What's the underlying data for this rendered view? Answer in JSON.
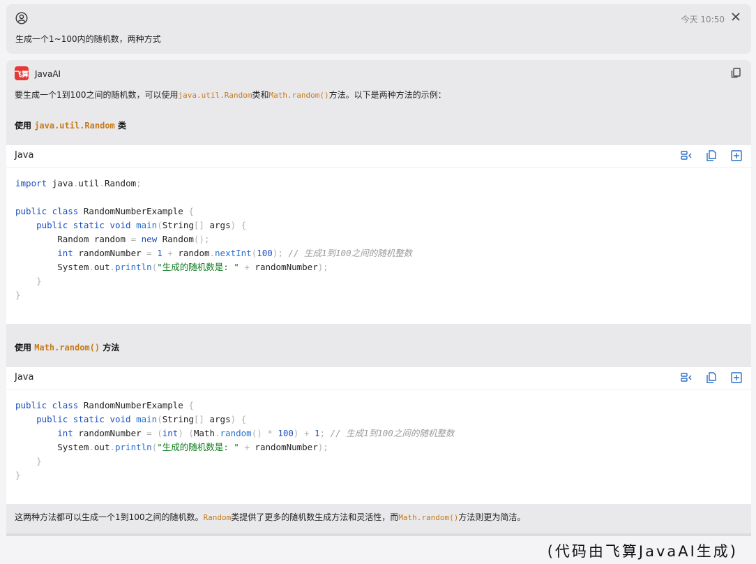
{
  "user_message": {
    "text": "生成一个1~100内的随机数，两种方式",
    "time": "今天 10:50"
  },
  "ai": {
    "name": "JavaAI",
    "logo_text": "飞算",
    "intro_pre": "要生成一个1到100之间的随机数，可以使用",
    "intro_code1": "java.util.Random",
    "intro_mid": "类和",
    "intro_code2": "Math.random()",
    "intro_post": "方法。以下是两种方法的示例：",
    "section1_prefix": "使用 ",
    "section1_code": "java.util.Random",
    "section1_suffix": " 类",
    "section2_prefix": "使用 ",
    "section2_code": "Math.random()",
    "section2_suffix": " 方法",
    "code1_lang": "Java",
    "code2_lang": "Java",
    "footer_pre": "这两种方法都可以生成一个1到100之间的随机数。",
    "footer_code1": "Random",
    "footer_mid": "类提供了更多的随机数生成方法和灵活性，而",
    "footer_code2": "Math.random()",
    "footer_post": "方法则更为简洁。"
  },
  "credit": "(代码由飞算JavaAI生成)",
  "icons": [
    "user-icon",
    "close-icon",
    "copy-icon",
    "insert-icon",
    "add-icon"
  ],
  "colors": {
    "accent": "#2a6fc9",
    "inline_code": "#c77a1a",
    "logo": "#e53935"
  }
}
